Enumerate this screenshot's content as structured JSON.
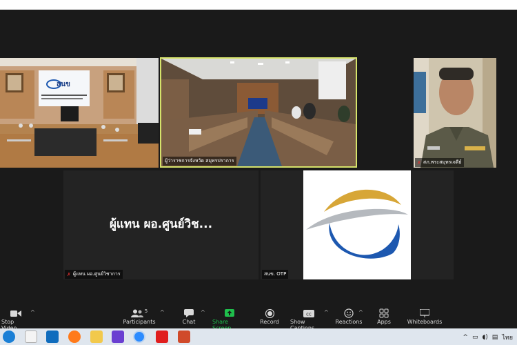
{
  "tiles": {
    "room_left": {
      "name": ""
    },
    "conference": {
      "name": "ผู้ว่าราชการจังหวัด สมุทรปราการ"
    },
    "officer": {
      "name": "สภ.พระสมุทรเจดีย์"
    },
    "representative": {
      "display_name": "ผู้แทน ผอ.ศูนย์วิช...",
      "name": "ผู้แทน ผอ.ศูนย์วิชาการ"
    },
    "otp": {
      "name": "สนข. OTP"
    }
  },
  "wall_sign": {
    "title": "สนข"
  },
  "toolbar": {
    "stop_video": "Stop Video",
    "participants": "Participants",
    "participants_count": "5",
    "chat": "Chat",
    "share_screen": "Share Screen",
    "record": "Record",
    "show_captions": "Show Captions",
    "reactions": "Reactions",
    "apps": "Apps",
    "whiteboards": "Whiteboards"
  },
  "taskbar": {
    "language": "ไทย"
  },
  "colors": {
    "active_speaker": "#d6e36b",
    "share_green": "#1fbf4c",
    "otp_gold": "#d7a637",
    "otp_blue": "#1d58b0",
    "otp_grey": "#b5b9be"
  }
}
